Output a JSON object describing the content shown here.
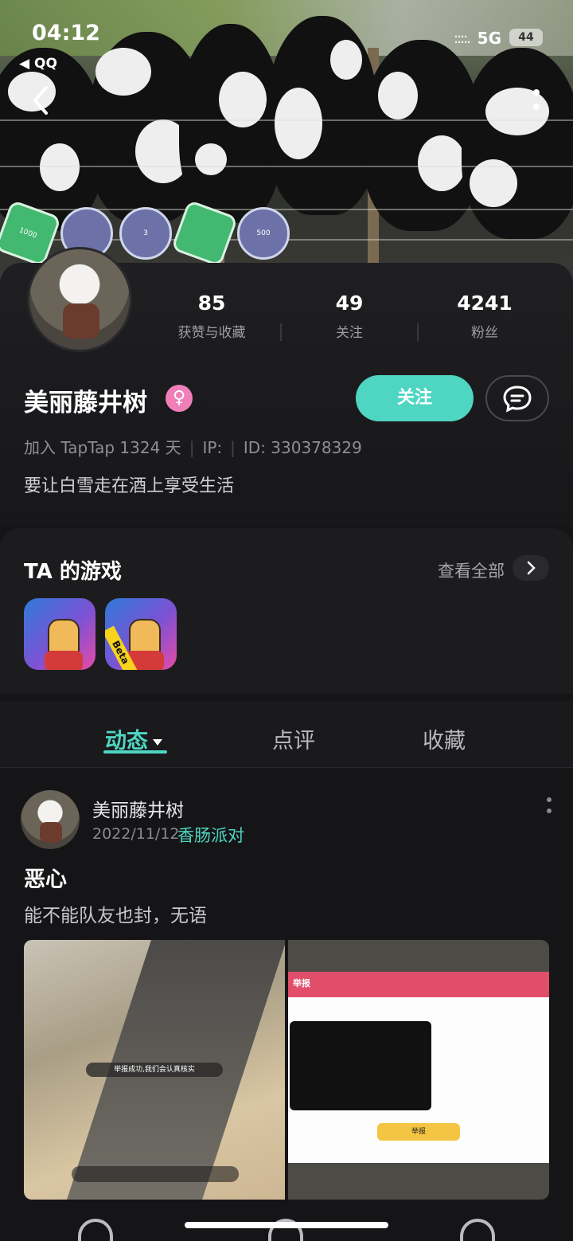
{
  "status_bar": {
    "time": "04:12",
    "back_app": "◀ QQ",
    "signal": "::::.",
    "network": "5G",
    "battery": "44"
  },
  "badges": [
    {
      "text": "1000",
      "style": "green"
    },
    {
      "text": "",
      "style": "purple"
    },
    {
      "text": "3",
      "style": "purple"
    },
    {
      "text": "",
      "style": "green"
    },
    {
      "text": "500",
      "style": "purple"
    }
  ],
  "profile": {
    "stats": [
      {
        "value": "85",
        "label": "获赞与收藏"
      },
      {
        "value": "49",
        "label": "关注"
      },
      {
        "value": "4241",
        "label": "粉丝"
      }
    ],
    "name": "美丽藤井树",
    "gender_symbol": "♀",
    "follow_label": "关注",
    "join_text": "加入 TapTap 1324 天",
    "ip_text": "IP:",
    "id_text": "ID: 330378329",
    "bio": "要让白雪走在酒上享受生活"
  },
  "games": {
    "title": "TA 的游戏",
    "see_all": "查看全部",
    "items": [
      {
        "beta": ""
      },
      {
        "beta": "Beta"
      }
    ]
  },
  "tabs": [
    {
      "label": "动态"
    },
    {
      "label": "点评"
    },
    {
      "label": "收藏"
    }
  ],
  "post": {
    "author": "美丽藤井树",
    "date": "2022/11/12",
    "game": "香肠派对",
    "title": "恶心",
    "text": "能不能队友也封，无语",
    "shot1_toast": "举报成功,我们会认真核实",
    "shot2_title": "举报",
    "shot2_button": "举报"
  },
  "colors": {
    "accent": "#4ed6c2",
    "background": "#151517",
    "card": "#1c1c1f",
    "gender": "#f07fb8"
  }
}
